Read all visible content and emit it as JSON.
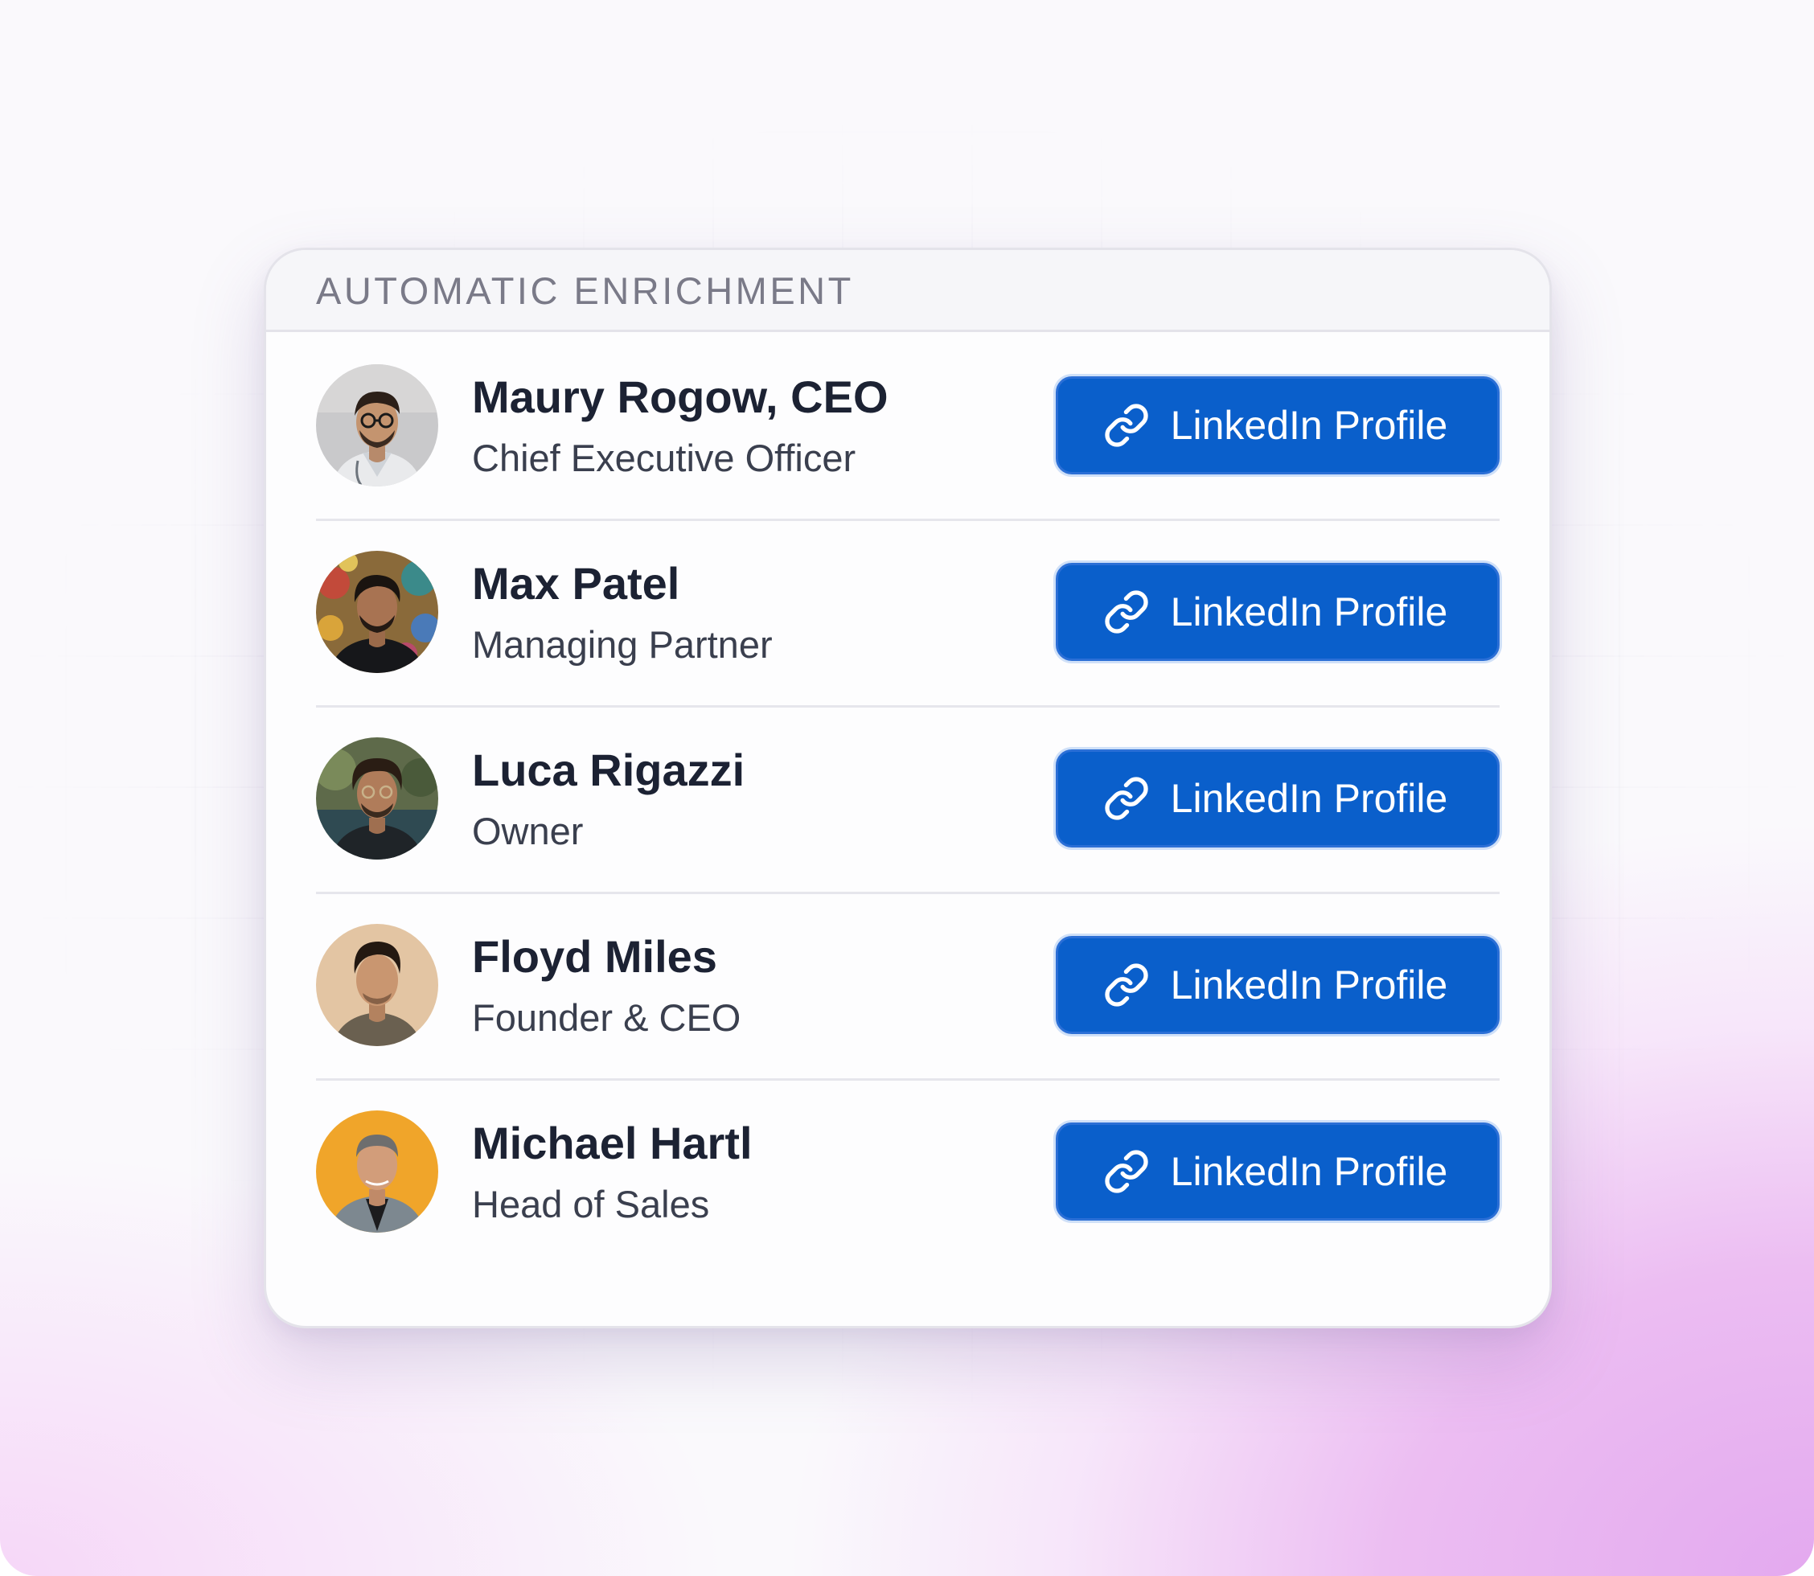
{
  "card": {
    "title": "AUTOMATIC ENRICHMENT"
  },
  "colors": {
    "button_bg": "#0a5fcb",
    "name_text": "#1c2233",
    "background_accent": "#e3a9ef"
  },
  "contacts": [
    {
      "name": "Maury Rogow, CEO",
      "title": "Chief Executive Officer",
      "button_label": "LinkedIn Profile",
      "button_icon": "link-icon",
      "avatar_icon": "avatar-photo"
    },
    {
      "name": "Max Patel",
      "title": "Managing Partner",
      "button_label": "LinkedIn Profile",
      "button_icon": "link-icon",
      "avatar_icon": "avatar-photo"
    },
    {
      "name": "Luca Rigazzi",
      "title": "Owner",
      "button_label": "LinkedIn Profile",
      "button_icon": "link-icon",
      "avatar_icon": "avatar-photo"
    },
    {
      "name": "Floyd Miles",
      "title": "Founder & CEO",
      "button_label": "LinkedIn Profile",
      "button_icon": "link-icon",
      "avatar_icon": "avatar-photo"
    },
    {
      "name": "Michael Hartl",
      "title": "Head of Sales",
      "button_label": "LinkedIn Profile",
      "button_icon": "link-icon",
      "avatar_icon": "avatar-photo"
    }
  ]
}
